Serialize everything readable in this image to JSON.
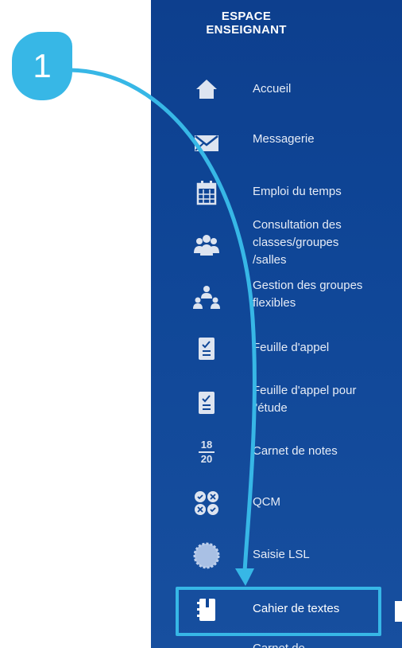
{
  "sidebar": {
    "title_line1": "ESPACE",
    "title_line2": "ENSEIGNANT",
    "items": [
      {
        "label": "Accueil",
        "icon": "home-icon"
      },
      {
        "label": "Messagerie",
        "icon": "envelope-icon"
      },
      {
        "label": "Emploi du temps",
        "icon": "calendar-icon"
      },
      {
        "label": "Consultation des classes/groupes /salles",
        "icon": "group-icon"
      },
      {
        "label": "Gestion des groupes flexibles",
        "icon": "flexible-groups-icon"
      },
      {
        "label": "Feuille d'appel",
        "icon": "checklist-icon"
      },
      {
        "label": "Feuille d'appel pour l'étude",
        "icon": "checklist-study-icon"
      },
      {
        "label": "Carnet de notes",
        "icon": "grade-fraction-icon",
        "frac_top": "18",
        "frac_bottom": "20"
      },
      {
        "label": "QCM",
        "icon": "qcm-icon"
      },
      {
        "label": "Saisie LSL",
        "icon": "badge-icon"
      },
      {
        "label": "Cahier de textes",
        "icon": "notebook-icon",
        "selected": true
      },
      {
        "label": "Carnet de",
        "icon": ""
      }
    ]
  },
  "annotation": {
    "step_number": "1",
    "color": "#37b7e6"
  }
}
